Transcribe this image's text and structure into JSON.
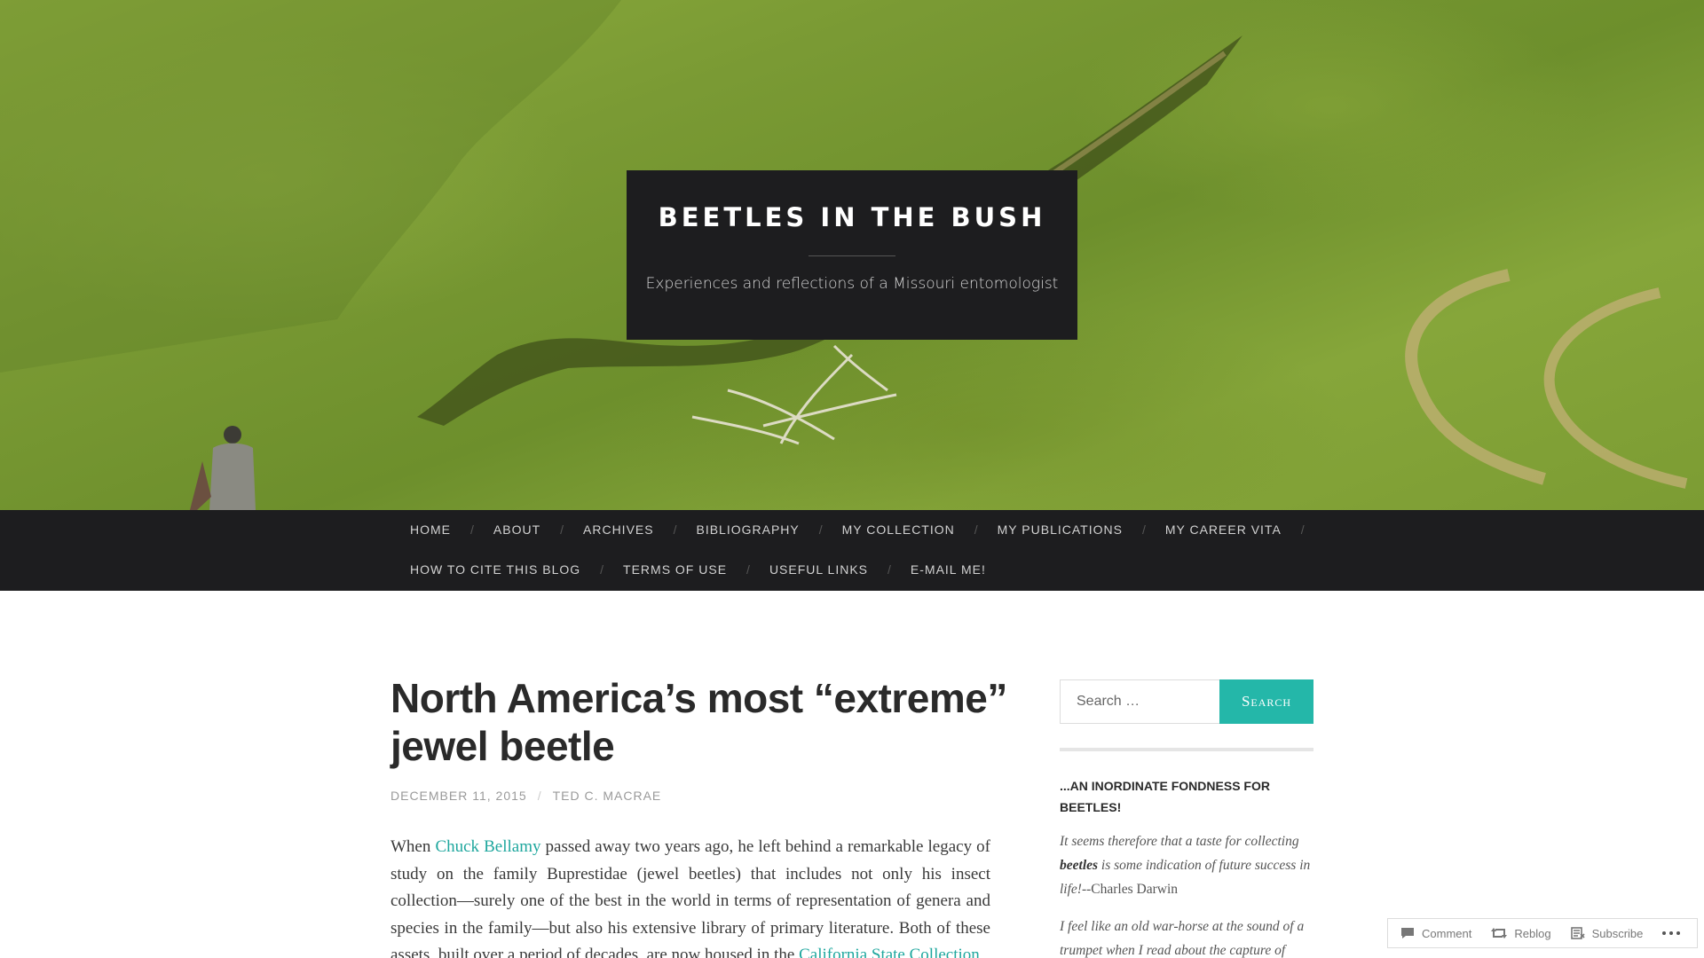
{
  "header": {
    "site_title": "BEETLES IN THE BUSH",
    "tagline": "Experiences and reflections of a Missouri entomologist"
  },
  "nav": {
    "row1": [
      "HOME",
      "ABOUT",
      "ARCHIVES",
      "BIBLIOGRAPHY",
      "MY COLLECTION",
      "MY PUBLICATIONS",
      "MY CAREER VITA"
    ],
    "row2": [
      "HOW TO CITE THIS BLOG",
      "TERMS OF USE",
      "USEFUL LINKS",
      "E-MAIL ME!"
    ],
    "separator": "/"
  },
  "post": {
    "title": "North America’s most “extreme” jewel beetle",
    "date": "DECEMBER 11, 2015",
    "meta_separator": "/",
    "author": "TED C. MACRAE",
    "body": {
      "p1_a": "When ",
      "link1": "Chuck Bellamy",
      "p1_b": " passed away two years ago, he left behind a remarkable legacy of study on the family Buprestidae (jewel beetles) that includes not only his insect collection—surely one of the best in the world in terms of representation of genera and species in the family—but also his extensive library of primary literature. Both of these assets, built over a period of decades, are now housed in the ",
      "link2": "California State Collection"
    }
  },
  "sidebar": {
    "search_placeholder": "Search …",
    "search_button": "Search",
    "widget_title": "...AN INORDINATE FONDNESS FOR BEETLES!",
    "quote1_a": "It seems therefore that a taste for collecting ",
    "quote1_bold": "beetles",
    "quote1_b": " is some indication of future success in life!",
    "quote1_author": "--Charles Darwin",
    "quote2": "I feel like an old war-horse at the sound of a trumpet when I read about the capture of"
  },
  "action_bar": {
    "comment": "Comment",
    "reblog": "Reblog",
    "subscribe": "Subscribe"
  }
}
